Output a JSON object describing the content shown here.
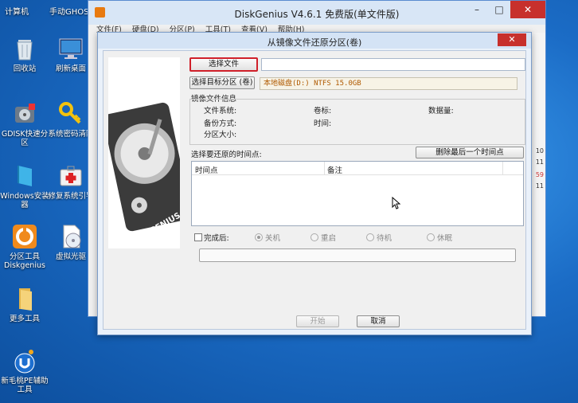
{
  "desktop": {
    "top_labels": [
      "计算机",
      "手动GHOST"
    ],
    "icons": [
      {
        "label": "回收站",
        "icon": "recycle-bin-icon"
      },
      {
        "label": "刷新桌面",
        "icon": "monitor-icon"
      },
      {
        "label": "GDISK快速分区",
        "icon": "gdisk-icon"
      },
      {
        "label": "系统密码清除",
        "icon": "key-icon"
      },
      {
        "label": "Windows安装器",
        "icon": "windows-installer-icon"
      },
      {
        "label": "修复系统引导",
        "icon": "first-aid-icon"
      },
      {
        "label": "分区工具Diskgenius",
        "icon": "diskgenius-icon"
      },
      {
        "label": "虚拟光驱",
        "icon": "virtual-drive-icon"
      },
      {
        "label": "更多工具",
        "icon": "folder-icon"
      },
      {
        "label": "新毛桃PE辅助工具",
        "icon": "pe-tool-icon"
      }
    ]
  },
  "app": {
    "title": "DiskGenius V4.6.1 免费版(单文件版)",
    "menu": [
      "文件(F)",
      "硬盘(D)",
      "分区(P)",
      "工具(T)",
      "查看(V)",
      "帮助(H)"
    ],
    "strip_labels": [
      "10",
      "11",
      "59",
      "11"
    ]
  },
  "dialog": {
    "title": "从镜像文件还原分区(卷)",
    "choose_file_label": "选择文件",
    "file_path": "",
    "choose_target_label": "选择目标分区 (卷)",
    "target_value": "本地磁盘(D:) NTFS 15.0GB",
    "image_info_title": "镜像文件信息",
    "fs_label": "文件系统:",
    "volume_label": "卷标:",
    "data_amount_label": "数据量:",
    "backup_mode_label": "备份方式:",
    "time_label": "时间:",
    "partition_size_label": "分区大小:",
    "restore_point_label": "选择要还原的时间点:",
    "delete_last_label": "删除最后一个时间点",
    "columns": [
      "时间点",
      "备注"
    ],
    "after_label": "完成后:",
    "after_options": [
      {
        "label": "关机",
        "selected": true
      },
      {
        "label": "重启",
        "selected": false
      },
      {
        "label": "待机",
        "selected": false
      },
      {
        "label": "休眠",
        "selected": false
      }
    ],
    "start_label": "开始",
    "cancel_label": "取消",
    "side_image_text": "DISK GENIUS"
  },
  "colors": {
    "desktop": "#1e73c9",
    "close_red": "#c7302c",
    "focus_red": "#d0202a",
    "target_text": "#b05a00"
  }
}
